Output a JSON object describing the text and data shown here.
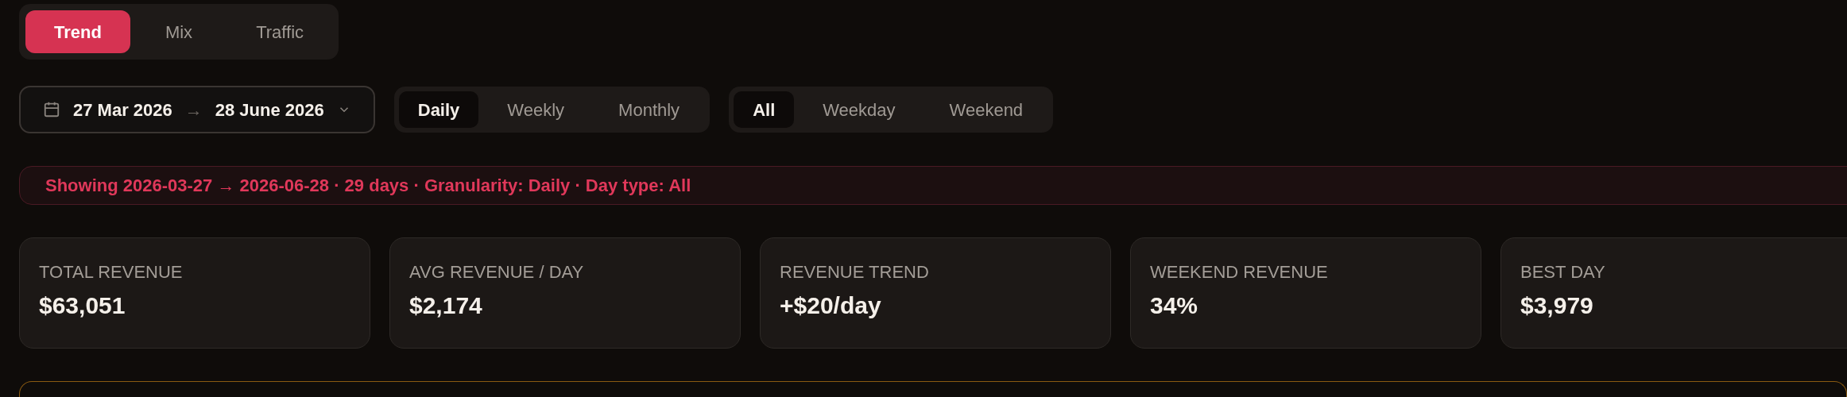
{
  "view_tabs": [
    {
      "label": "Trend",
      "selected": true
    },
    {
      "label": "Mix",
      "selected": false
    },
    {
      "label": "Traffic",
      "selected": false
    }
  ],
  "date_range": {
    "start": "27 Mar 2026",
    "arrow": "→",
    "end": "28 June 2026"
  },
  "granularity": [
    {
      "label": "Daily",
      "selected": true
    },
    {
      "label": "Weekly",
      "selected": false
    },
    {
      "label": "Monthly",
      "selected": false
    }
  ],
  "day_type": [
    {
      "label": "All",
      "selected": true
    },
    {
      "label": "Weekday",
      "selected": false
    },
    {
      "label": "Weekend",
      "selected": false
    }
  ],
  "banner": "Showing 2026-03-27 → 2026-06-28 · 29 days · Granularity: Daily · Day type: All",
  "stats": [
    {
      "label": "TOTAL REVENUE",
      "value": "$63,051"
    },
    {
      "label": "AVG REVENUE / DAY",
      "value": "$2,174"
    },
    {
      "label": "REVENUE TREND",
      "value": "+$20/day"
    },
    {
      "label": "WEEKEND REVENUE",
      "value": "34%"
    },
    {
      "label": "BEST DAY",
      "value": "$3,979"
    }
  ]
}
